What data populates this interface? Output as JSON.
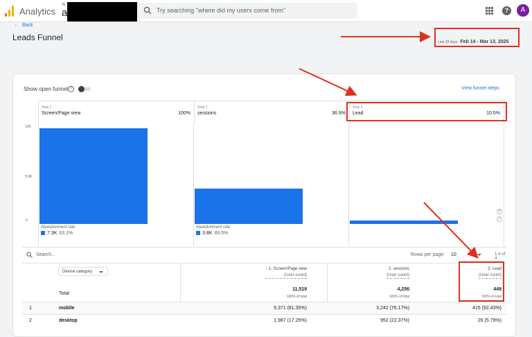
{
  "topbar": {
    "app_title": "Analytics",
    "account_prefix": "Al",
    "account_name": "a",
    "search_placeholder": "Try searching \"where did my users come from\"",
    "avatar_letter": "A",
    "help_glyph": "?"
  },
  "nav": {
    "back_label": "Back"
  },
  "page": {
    "title": "Leads Funnel",
    "date_range_label": "Last 28 days",
    "date_range": "Feb 14 - Mar 13, 2025"
  },
  "funnel": {
    "show_open_funnel_label": "Show open funnel",
    "view_funnel_steps_label": "View funnel steps",
    "steps": [
      {
        "number": "Step 1",
        "name": "Screen/Page view",
        "percent": "100%"
      },
      {
        "number": "Step 2",
        "name": "sessions",
        "percent": "36.9%"
      },
      {
        "number": "Step 3",
        "name": "Lead",
        "percent": "10.5%"
      }
    ],
    "abandonment": [
      {
        "label": "Abandonment rate",
        "count": "7.3K",
        "percent": "63.1%"
      },
      {
        "label": "Abandonment rate",
        "count": "3.8K",
        "percent": "89.5%"
      }
    ]
  },
  "chart_data": {
    "type": "bar",
    "categories": [
      "Screen/Page view",
      "sessions",
      "Lead"
    ],
    "values": [
      11519,
      4256,
      449
    ],
    "ylim": [
      0,
      12000
    ],
    "yticks": [
      "12K",
      "5.9K",
      "0"
    ],
    "grid": true
  },
  "table": {
    "search_placeholder": "Search...",
    "rows_per_page_label": "Rows per page:",
    "rows_per_page_value": "10",
    "pagination": "1-4 of 4",
    "dimension_label": "Device category",
    "columns": [
      {
        "title": "↓ 1. Screen/Page view",
        "subtitle": "(User count)"
      },
      {
        "title": "2. sessions",
        "subtitle": "(User count)"
      },
      {
        "title": "3. Lead",
        "subtitle": "(User count)"
      }
    ],
    "total": {
      "label": "Total",
      "values": [
        "11,519",
        "4,256",
        "449"
      ],
      "sublabel": "100% of total"
    },
    "rows": [
      {
        "n": "1",
        "device": "mobile",
        "values": [
          "9,371 (81.35%)",
          "3,242 (76.17%)",
          "415 (92.43%)"
        ]
      },
      {
        "n": "2",
        "device": "desktop",
        "values": [
          "1,987 (17.25%)",
          "952 (22.37%)",
          "26 (5.79%)"
        ]
      }
    ]
  },
  "colors": {
    "accent": "#1a73e8",
    "annotation": "#e02f1f",
    "avatar": "#7b1fa2"
  },
  "icons": [
    "analytics-logo-icon",
    "search-icon",
    "apps-grid-icon",
    "help-icon",
    "back-arrow-icon",
    "question-icon",
    "zoom-in-icon",
    "zoom-out-icon",
    "dropdown-caret-icon"
  ]
}
